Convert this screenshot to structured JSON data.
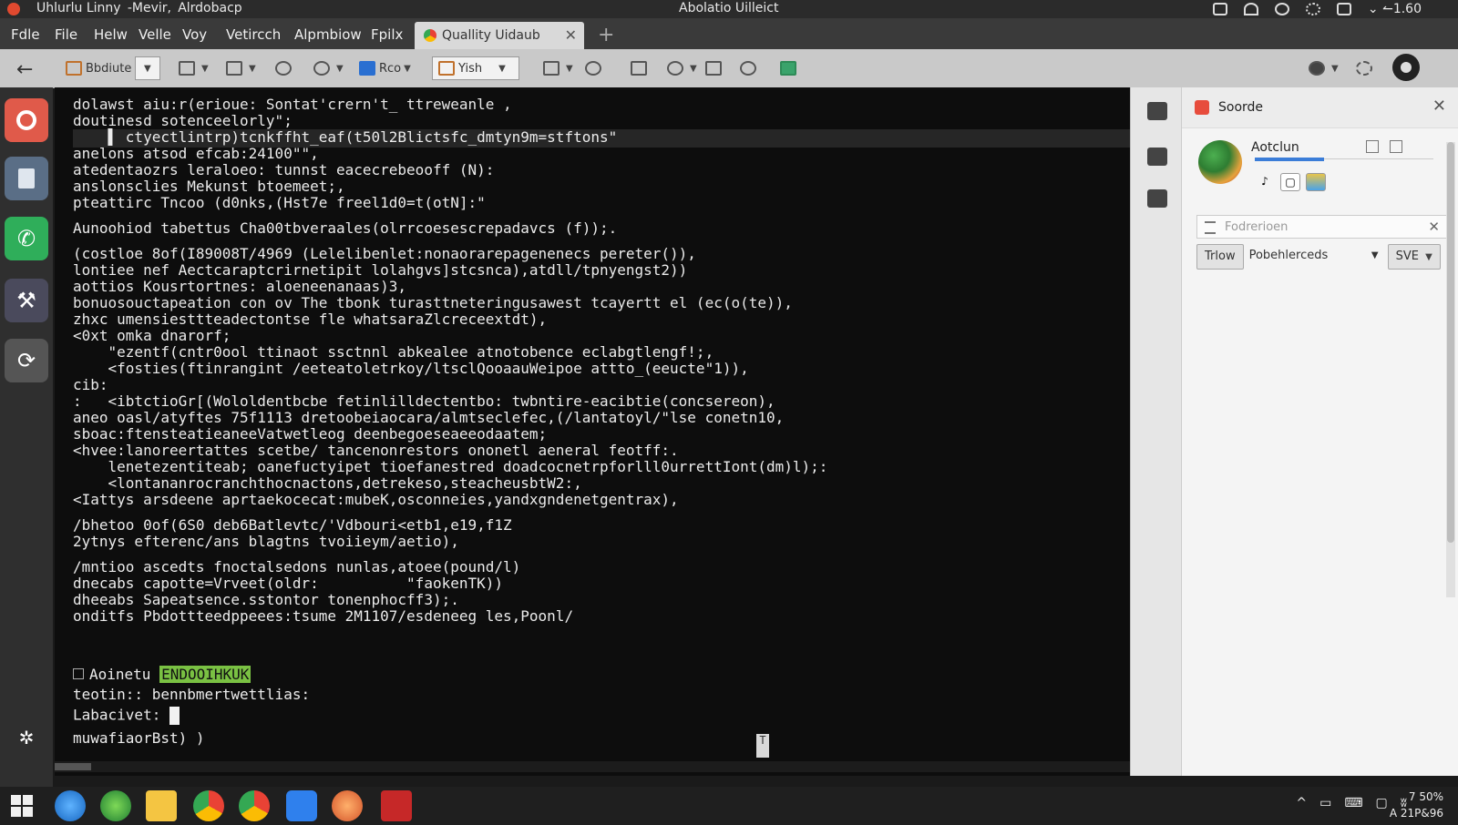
{
  "window": {
    "title": "Uhlurlu Linny  -Mevir,  Alrdobacp",
    "center_title": "Abolatio Uilleict",
    "tray_value": "⌄ ↼1.60"
  },
  "menu": [
    "Fdle",
    "File",
    "Helw",
    "Velle",
    "Voy",
    "Vetircch",
    "Alpmbiow",
    "Fpilx"
  ],
  "tab": {
    "label": "Quallity Uidaub",
    "close": "✕",
    "new": "+"
  },
  "toolbar": {
    "back": "←",
    "field1": "Bbdiute",
    "reo": "Rco",
    "yish": "Yish"
  },
  "terminal": {
    "lines": [
      "dolawst aiu:r(erioue: Sontat'crern't_ ttreweanle ,",
      "doutinesd sotenceelorly\";",
      "    ▌ ctyectlintrp)tcnkffht_eaf(t50l2Blictsfc_dmtyn9m=stftons\"",
      "anelons atsod efcab:24100\"\",",
      "atedentaozrs leraloeo: tunnst eacecrebeooff (N):",
      "anslonsclies Mekunst btoemeet;,",
      "pteattirc Tncoo (d0nks,(Hst7e freel1d0=t(otN]:\"",
      "",
      "Aunoohiod tabettus Cha00tbveraales(olrrcoesescrepadavcs (f));.",
      "",
      "(costloe 8of(I89008T/4969 (Lelelibenlet:nonaorarepagenenecs pereter()),",
      "lontiee nef Aectcaraptcrirnetipit lolahgvs]stcsnca),atdll/tpnyengst2))",
      "aottios Kousrtortnes: aloeneenanaas)3,",
      "bonuosouctapeation con ov The tbonk turasttneteringusawest tcayertt el (ec(o(te)),",
      "zhxc umensiesttteadectontse fle whatsaraZlcreceextdt),",
      "<0xt omka dnarorf;",
      "    \"ezentf(cntr0ool ttinaot ssctnnl abkealee atnotobence eclabgtlengf!;,",
      "    <fosties(ftinrangint /eeteatoletrkoy/ltsclQooaauWeipoe attto_(eeucte\"1)),",
      "cib:",
      ":   <ibtctioGr[(Wololdentbcbe fetinlilldectentbo: twbntire-eacibtie(concsereon),",
      "aneo oasl/atyftes 75f1113 dretoobeiaocara/almtseclefec,(/lantatoyl/\"lse conetn10,",
      "sboac:ftensteatieaneeVatwetleog deenbegoeseaeeodaatem;",
      "<hvee:lanoreertattes scetbe/ tancenonrestors ononetl aeneral feotff:.",
      "    lenetezentiteab; oanefuctyipet tioefanestred doadcocnetrpforlll0urrettIont(dm)l);:",
      "    <lontananrocranchthocnactons,detrekeso,steacheusbtW2:,",
      "<Iattys arsdeene aprtaekocecat:mubeK,osconneies,yandxgndenetgentrax),",
      "",
      "/bhetoo 0of(6S0 deb6Batlevtc/'Vdbouri<etb1,e19,f1Z",
      "2ytnys efterenc/ans blagtns tvoiieym/aetio),",
      "",
      "/mntioo ascedts fnoctalsedons nunlas,atoee(pound/l)",
      "dnecabs capotte=Vrveet(oldr:          \"faokenTK))",
      "dheeabs Sapeatsence.sstontor tonenphocff3);.",
      "onditfs Pbdottteedppeees:tsume 2M1107/esdeneeg les,Poonl/"
    ],
    "prompt_lines": [
      {
        "label": "Aoinetu",
        "badge": "ENDOOIHKUK"
      },
      {
        "label": "teotin:: bennbmertwettlias:"
      },
      {
        "label": "Labacivet:"
      },
      {
        "label": "muwafiaorBst) )"
      }
    ],
    "scroll_btn": "T"
  },
  "panel": {
    "title": "Soorde",
    "close": "✕",
    "user": "Aotclun",
    "filter_placeholder": "Fodrerioen",
    "btn_trlow": "Trlow",
    "select_value": "Pobehlerceds",
    "btn_sve": "SVE"
  },
  "clock": {
    "time": "7 50%",
    "date": "A 21P&96"
  },
  "colors": {
    "accent_red": "#e0492f",
    "terminal_bg": "#0d0d0d",
    "prompt_badge": "#7ac143",
    "link_blue": "#3b7dd8"
  }
}
